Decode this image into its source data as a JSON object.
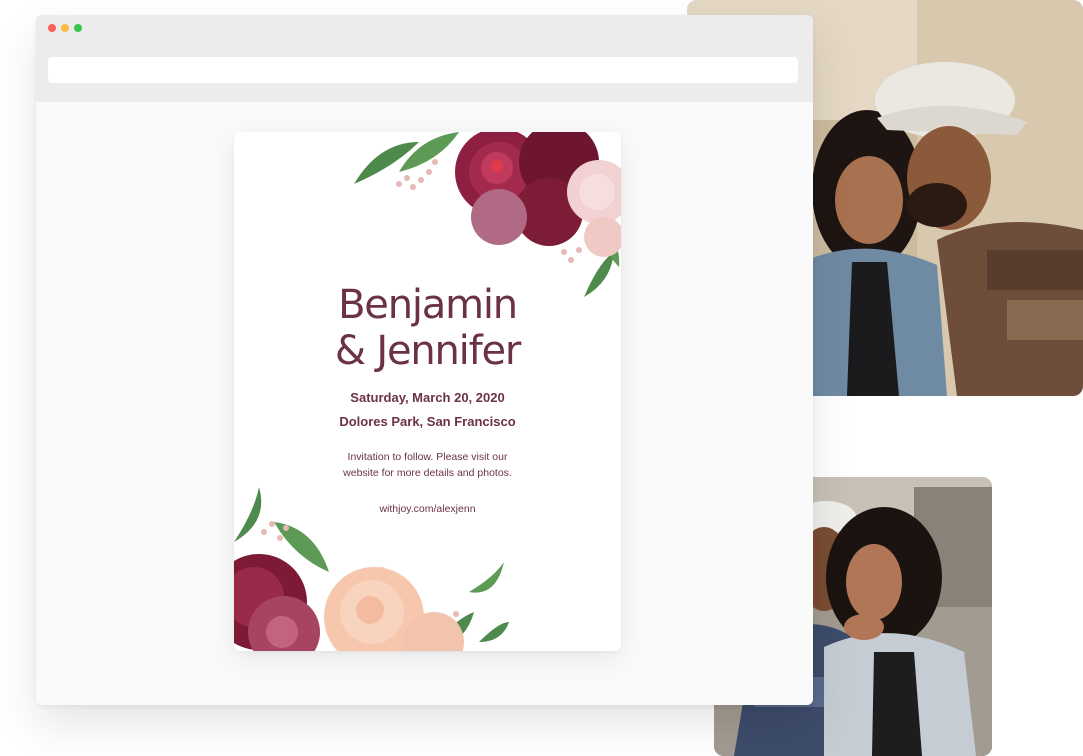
{
  "browser": {
    "window_controls": [
      "close",
      "minimize",
      "maximize"
    ],
    "address": ""
  },
  "invitation": {
    "name_line_1": "Benjamin",
    "name_line_2": "& Jennifer",
    "date": "Saturday, March 20, 2020",
    "venue": "Dolores Park, San Francisco",
    "note_line_1": "Invitation to follow. Please visit our",
    "note_line_2": "website for more details and photos.",
    "url": "withjoy.com/alexjenn"
  },
  "colors": {
    "text": "#6b3245",
    "burgundy": "#8a1e3c",
    "blush": "#f3c9b6",
    "leaf": "#4d8a4a",
    "chrome": "#ececec",
    "page": "#fafafa"
  }
}
